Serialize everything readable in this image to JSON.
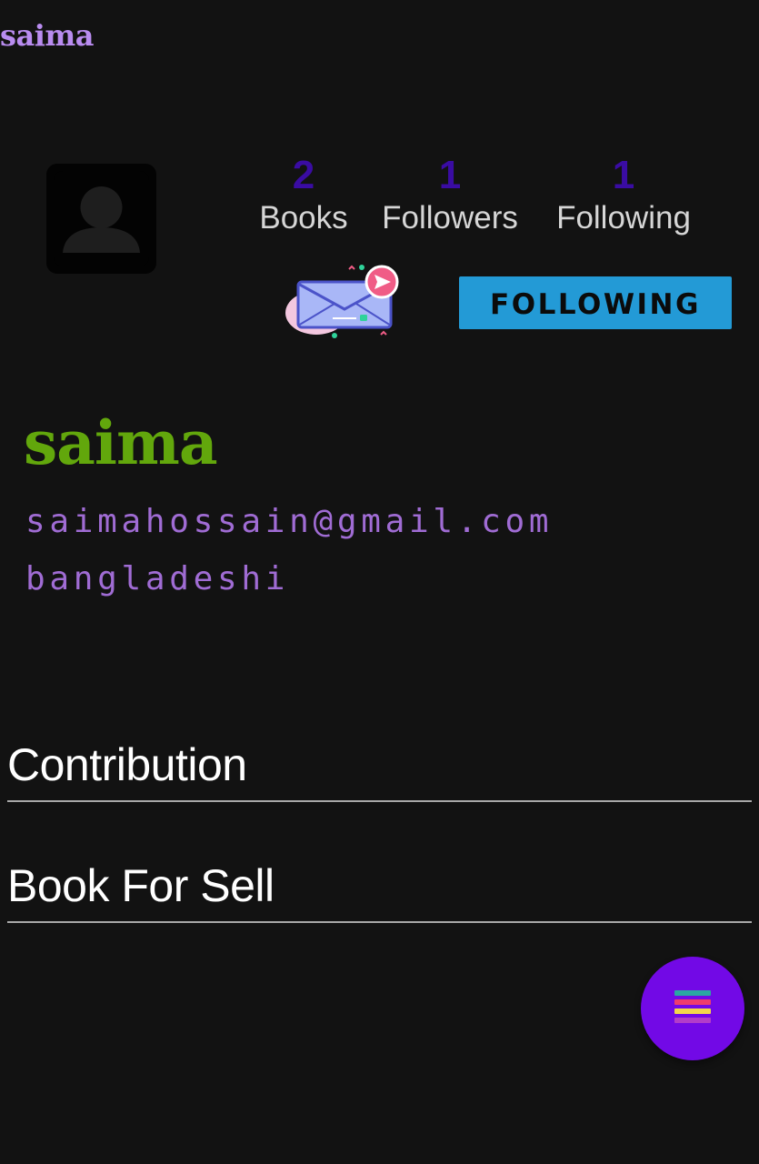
{
  "appbar": {
    "title": "saima"
  },
  "profile": {
    "avatar_icon": "person-placeholder-icon",
    "stats": [
      {
        "value": "2",
        "label": "Books"
      },
      {
        "value": "1",
        "label": "Followers"
      },
      {
        "value": "1",
        "label": "Following"
      }
    ],
    "message_icon": "envelope-send-icon",
    "follow_button_label": "FOLLOWING",
    "name": "saima",
    "email": "saimahossain@gmail.com",
    "bio": "bangladeshi"
  },
  "sections": {
    "contribution": "Contribution",
    "book_for_sell": "Book For Sell"
  },
  "fab": {
    "icon": "menu-lines-icon"
  },
  "colors": {
    "background": "#121212",
    "appbar_title": "#b98cf0",
    "stat_value": "#3a0ca3",
    "stat_label": "#d6d6d6",
    "follow_button": "#239ad6",
    "name": "#62a70c",
    "email_bio": "#a06cd4",
    "fab": "#7209e6"
  }
}
